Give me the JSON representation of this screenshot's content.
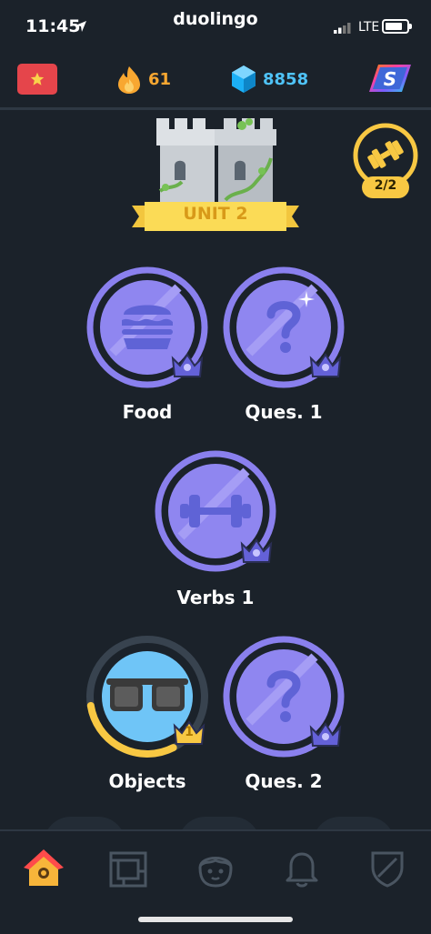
{
  "status_bar": {
    "time": "11:45",
    "network": "LTE"
  },
  "app": {
    "title": "duolingo"
  },
  "stats": {
    "streak": "61",
    "gems": "8858"
  },
  "unit": {
    "label": "UNIT 2",
    "practice_progress": "2/2"
  },
  "skills": [
    {
      "name": "Food",
      "icon": "burger-icon",
      "crown_level": ""
    },
    {
      "name": "Ques. 1",
      "icon": "question-icon",
      "crown_level": ""
    },
    {
      "name": "Verbs 1",
      "icon": "dumbbell-icon",
      "crown_level": ""
    },
    {
      "name": "Objects",
      "icon": "sunglasses-icon",
      "crown_level": "1",
      "progress": 0.3
    },
    {
      "name": "Ques. 2",
      "icon": "question-icon",
      "crown_level": ""
    }
  ],
  "nav": {
    "items": [
      "home-icon",
      "map-icon",
      "profile-icon",
      "bell-icon",
      "shield-icon"
    ],
    "active": "home-icon"
  },
  "colors": {
    "background": "#1b222a",
    "skill_purple": "#8f86f0",
    "skill_ring": "#8a80ee",
    "gold": "#f8c843",
    "objects_blue": "#6fc5f7",
    "flame": "#f8a731",
    "gem": "#4fc3f7"
  }
}
